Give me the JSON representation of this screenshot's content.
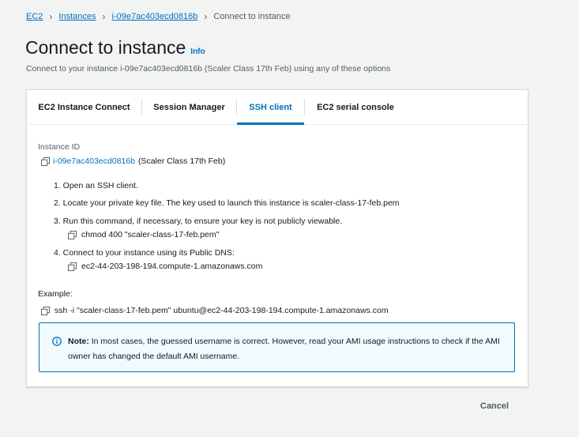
{
  "breadcrumb": {
    "items": [
      "EC2",
      "Instances",
      "i-09e7ac403ecd0816b"
    ],
    "current": "Connect to instance"
  },
  "header": {
    "title": "Connect to instance",
    "info": "Info",
    "description": "Connect to your instance i-09e7ac403ecd0816b (Scaler Class 17th Feb) using any of these options"
  },
  "tabs": [
    {
      "label": "EC2 Instance Connect",
      "active": false
    },
    {
      "label": "Session Manager",
      "active": false
    },
    {
      "label": "SSH client",
      "active": true
    },
    {
      "label": "EC2 serial console",
      "active": false
    }
  ],
  "instance": {
    "label": "Instance ID",
    "id": "i-09e7ac403ecd0816b",
    "name": "(Scaler Class 17th Feb)"
  },
  "steps": {
    "s1": "1. Open an SSH client.",
    "s2": "2. Locate your private key file. The key used to launch this instance is scaler-class-17-feb.pem",
    "s3": "3. Run this command, if necessary, to ensure your key is not publicly viewable.",
    "s3_cmd": "chmod 400 \"scaler-class-17-feb.pem\"",
    "s4": "4. Connect to your instance using its Public DNS:",
    "s4_dns": "ec2-44-203-198-194.compute-1.amazonaws.com"
  },
  "example": {
    "label": "Example:",
    "command": "ssh -i \"scaler-class-17-feb.pem\" ubuntu@ec2-44-203-198-194.compute-1.amazonaws.com"
  },
  "note": {
    "strong": "Note:",
    "text": " In most cases, the guessed username is correct. However, read your AMI usage instructions to check if the AMI owner has changed the default AMI username."
  },
  "actions": {
    "cancel": "Cancel"
  },
  "colors": {
    "link": "#0073bb",
    "background": "#f2f3f3",
    "note_bg": "#f1faff"
  }
}
